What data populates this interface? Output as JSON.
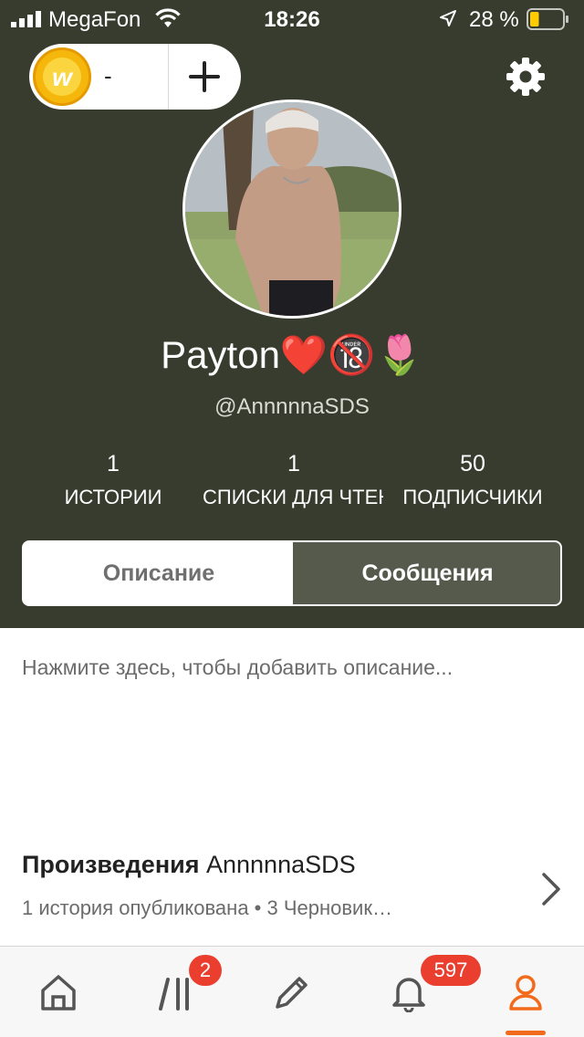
{
  "status_bar": {
    "carrier": "MegaFon",
    "time": "18:26",
    "battery_percent": "28 %",
    "battery_level": 0.28
  },
  "coins": {
    "count": "-",
    "coin_symbol": "w",
    "add_icon": "plus-icon"
  },
  "settings_icon": "gear-icon",
  "profile": {
    "display_name": "Payton❤️🔞🌷",
    "username": "@AnnnnnaSDS"
  },
  "stats": [
    {
      "value": "1",
      "label": "ИСТОРИИ"
    },
    {
      "value": "1",
      "label": "СПИСКИ ДЛЯ ЧТЕНИЯ"
    },
    {
      "value": "50",
      "label": "ПОДПИСЧИКИ"
    }
  ],
  "tabs": {
    "about": "Описание",
    "messages": "Сообщения",
    "active": "messages"
  },
  "about_placeholder": "Нажмите здесь, чтобы добавить описание...",
  "works": {
    "title_bold": "Произведения",
    "owner": "AnnnnnaSDS",
    "subtitle": "1 история опубликована • 3 Черновик…"
  },
  "tab_bar": {
    "items": [
      {
        "icon": "home-icon"
      },
      {
        "icon": "library-icon",
        "badge": "2"
      },
      {
        "icon": "pencil-icon"
      },
      {
        "icon": "bell-icon",
        "badge": "597"
      },
      {
        "icon": "profile-icon",
        "active": true
      }
    ]
  },
  "colors": {
    "header_bg": "#383c2e",
    "accent": "#f26a1b",
    "badge": "#ea3f2f",
    "active_tab_bg": "#565a4d"
  }
}
